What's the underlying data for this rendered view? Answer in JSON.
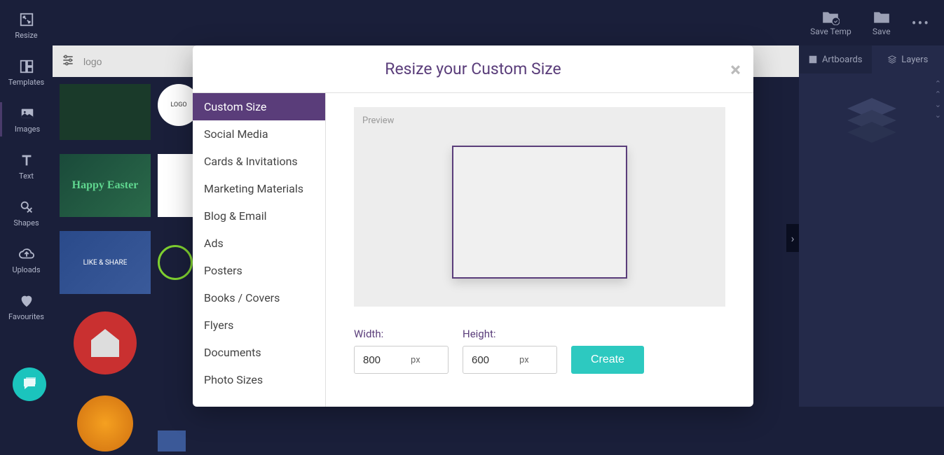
{
  "sidebar": {
    "items": [
      {
        "label": "Resize"
      },
      {
        "label": "Templates"
      },
      {
        "label": "Images"
      },
      {
        "label": "Text"
      },
      {
        "label": "Shapes"
      },
      {
        "label": "Uploads"
      },
      {
        "label": "Favourites"
      }
    ]
  },
  "toolbar": {
    "save_temp": "Save Temp",
    "save": "Save"
  },
  "search": {
    "value": "logo"
  },
  "right_panel": {
    "tabs": [
      {
        "label": "Artboards"
      },
      {
        "label": "Layers"
      }
    ]
  },
  "modal": {
    "title": "Resize your Custom Size",
    "categories": [
      "Custom Size",
      "Social Media",
      "Cards & Invitations",
      "Marketing Materials",
      "Blog & Email",
      "Ads",
      "Posters",
      "Books / Covers",
      "Flyers",
      "Documents",
      "Photo Sizes"
    ],
    "preview_label": "Preview",
    "width_label": "Width:",
    "height_label": "Height:",
    "width_value": "800",
    "height_value": "600",
    "unit": "px",
    "create_label": "Create"
  },
  "thumbs": {
    "easter": "Happy Easter",
    "like": "LIKE & SHARE"
  }
}
